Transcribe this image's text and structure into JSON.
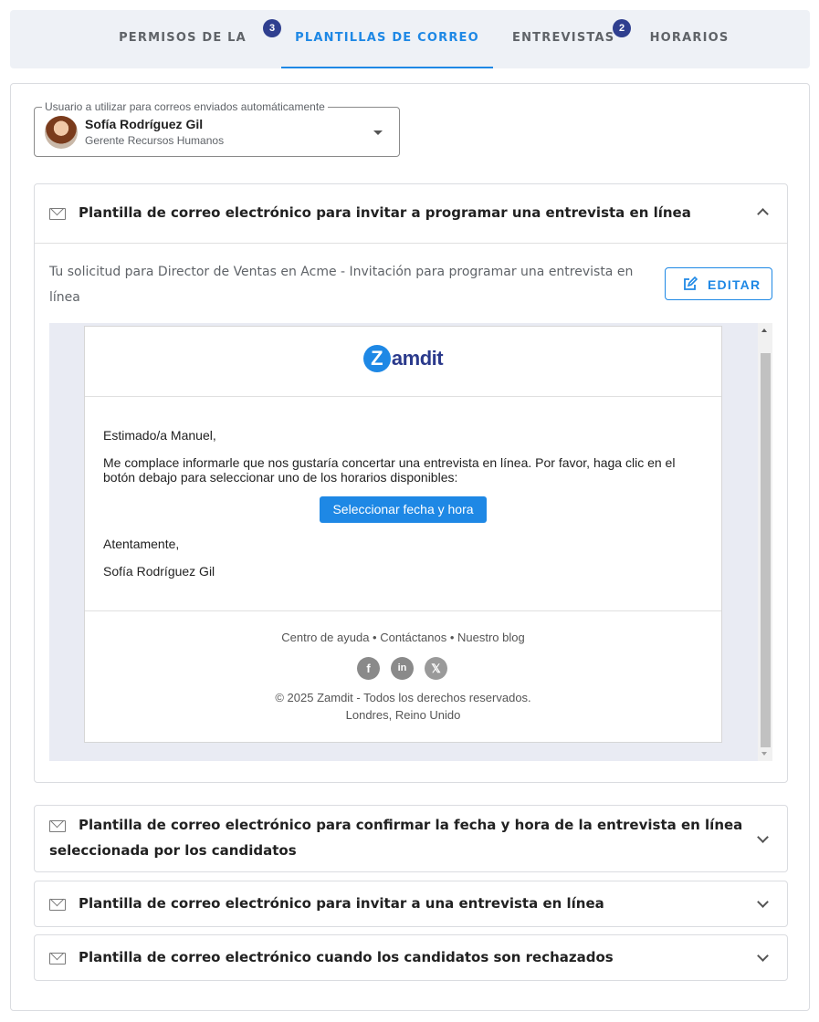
{
  "tabs": [
    {
      "label": "PERMISOS DE LA ETAPA",
      "badge": "3",
      "active": false
    },
    {
      "label": "PLANTILLAS DE CORREO",
      "badge": "",
      "active": true
    },
    {
      "label": "ENTREVISTAS",
      "badge": "2",
      "active": false
    },
    {
      "label": "HORARIOS",
      "badge": "",
      "active": false
    }
  ],
  "sender": {
    "legend": "Usuario a utilizar para correos enviados automáticamente",
    "name": "Sofía Rodríguez Gil",
    "role": "Gerente Recursos Humanos"
  },
  "templates": [
    {
      "title": "Plantilla de correo electrónico para invitar a programar una entrevista en línea",
      "expanded": true
    },
    {
      "title": "Plantilla de correo electrónico para confirmar la fecha y hora de la entrevista en línea seleccionada por los candidatos",
      "expanded": false
    },
    {
      "title": "Plantilla de correo electrónico para invitar a una entrevista en línea",
      "expanded": false
    },
    {
      "title": "Plantilla de correo electrónico cuando los candidatos son rechazados",
      "expanded": false
    }
  ],
  "expanded": {
    "subject": "Tu solicitud para Director de Ventas en Acme - Invitación para programar una entrevista en línea",
    "edit_label": "EDITAR"
  },
  "email": {
    "logo_mark": "Z",
    "logo_text": "amdit",
    "greeting": "Estimado/a Manuel,",
    "body": "Me complace informarle que nos gustaría concertar una entrevista en línea. Por favor, haga clic en el botón debajo para seleccionar uno de los horarios disponibles:",
    "cta": "Seleccionar fecha y hora",
    "closing": "Atentamente,",
    "signature": "Sofía Rodríguez Gil",
    "footer_links": [
      "Centro de ayuda",
      "Contáctanos",
      "Nuestro blog"
    ],
    "footer_sep": " • ",
    "socials": [
      "facebook-icon",
      "linkedin-icon",
      "x-icon"
    ],
    "social_glyphs": {
      "facebook": "f",
      "linkedin": "in",
      "x": "𝕏"
    },
    "copyright": "© 2025 Zamdit - Todos los derechos reservados.",
    "location": "Londres, Reino Unido"
  },
  "colors": {
    "accent": "#1e88e5",
    "badge": "#2f3f8f",
    "brand_dark": "#2b3a8c"
  }
}
